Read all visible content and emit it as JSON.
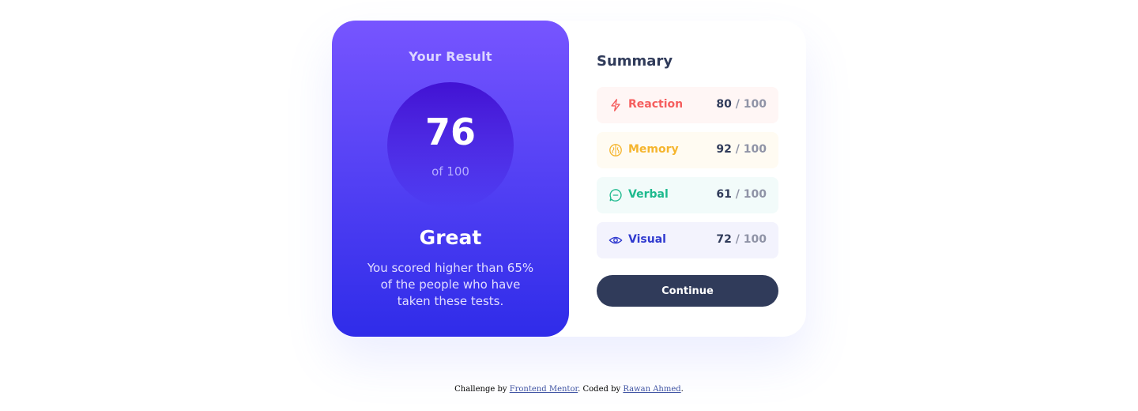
{
  "result": {
    "title": "Your Result",
    "score": "76",
    "score_of": "of 100",
    "rating": "Great",
    "description": "You scored higher than 65% of the people who have taken these tests."
  },
  "summary": {
    "title": "Summary",
    "items": [
      {
        "label": "Reaction",
        "score": "80",
        "of": "/ 100",
        "icon": "lightning-icon",
        "color": "#F55E5E",
        "bg": "#FFF6F5"
      },
      {
        "label": "Memory",
        "score": "92",
        "of": "/ 100",
        "icon": "brain-icon",
        "color": "#F5B52E",
        "bg": "#FFFBF2"
      },
      {
        "label": "Verbal",
        "score": "61",
        "of": "/ 100",
        "icon": "chat-icon",
        "color": "#1EBA8E",
        "bg": "#F2FBFA"
      },
      {
        "label": "Visual",
        "score": "72",
        "of": "/ 100",
        "icon": "eye-icon",
        "color": "#2F39CF",
        "bg": "#F3F3FD"
      }
    ],
    "continue_label": "Continue"
  },
  "footer": {
    "prefix": "Challenge by ",
    "link1": "Frontend Mentor",
    "middle": ". Coded by ",
    "link2": "Rawan Ahmed",
    "suffix": "."
  },
  "colors": {
    "gradient_top": "#7755FF",
    "gradient_bottom": "#2F2CE9",
    "dark_navy": "#303B5A"
  }
}
